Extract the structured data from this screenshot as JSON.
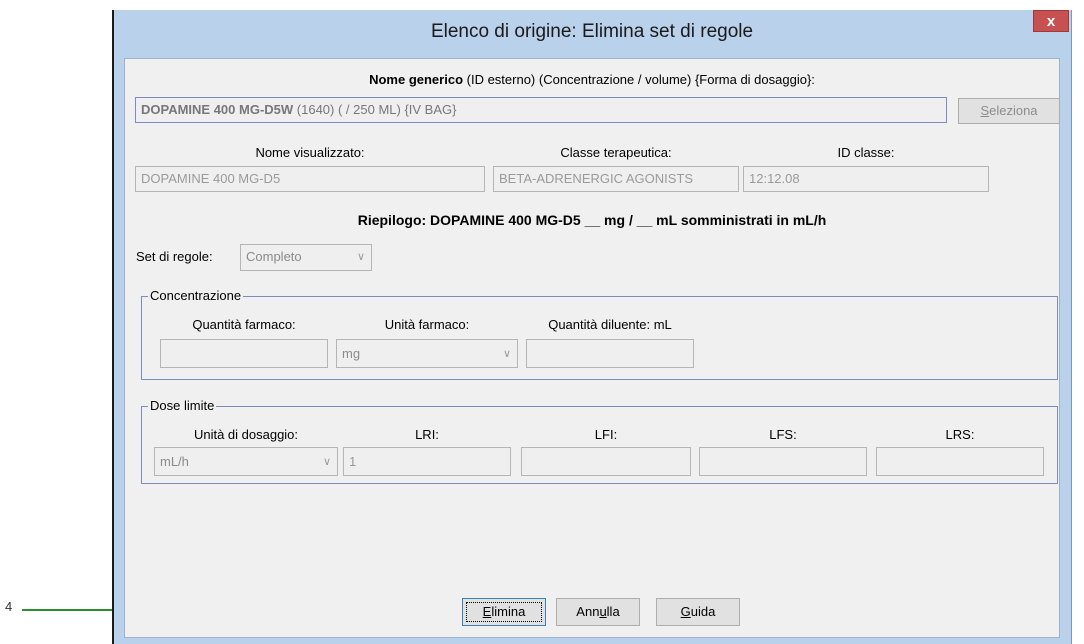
{
  "window": {
    "title": "Elenco di origine: Elimina set di regole",
    "close_label": "x"
  },
  "header": {
    "generic_bold": "Nome generico",
    "generic_rest": " (ID esterno) (Concentrazione / volume) {Forma di dosaggio}:",
    "generic_value_bold": "DOPAMINE 400 MG-D5W",
    "generic_value_rest": " (1640) ( / 250 ML) {IV BAG}",
    "select_label_pre": "",
    "select_label_u": "S",
    "select_label_post": "eleziona"
  },
  "info": {
    "display_name_label": "Nome visualizzato:",
    "display_name_value": "DOPAMINE 400 MG-D5",
    "therapeutic_class_label": "Classe terapeutica:",
    "therapeutic_class_value": "BETA-ADRENERGIC AGONISTS",
    "class_id_label": "ID classe:",
    "class_id_value": "12:12.08"
  },
  "summary": "Riepilogo: DOPAMINE 400 MG-D5 __ mg / __ mL somministrati in mL/h",
  "ruleset": {
    "label": "Set di regole:",
    "value": "Completo"
  },
  "concentration": {
    "legend": "Concentrazione",
    "drug_amount_label": "Quantità farmaco:",
    "drug_amount_value": "",
    "drug_unit_label": "Unità farmaco:",
    "drug_unit_value": "mg",
    "diluent_label": "Quantità diluente: mL",
    "diluent_value": ""
  },
  "dose_limits": {
    "legend": "Dose limite",
    "dosing_unit_label": "Unità di dosaggio:",
    "dosing_unit_value": "mL/h",
    "lri_label": "LRI:",
    "lri_value": "1",
    "lfi_label": "LFI:",
    "lfi_value": "",
    "lfs_label": "LFS:",
    "lfs_value": "",
    "lrs_label": "LRS:",
    "lrs_value": ""
  },
  "buttons": {
    "delete_u": "E",
    "delete_rest": "limina",
    "cancel_pre": "Ann",
    "cancel_u": "u",
    "cancel_post": "lla",
    "help_u": "G",
    "help_rest": "uida"
  },
  "callout": {
    "number": "4",
    "line_color": "#2e8b2e"
  },
  "colors": {
    "window_frame": "#b9d1ea",
    "client_bg": "#f0f0f0",
    "close_button": "#c75050",
    "group_border": "#7a8cc0"
  }
}
